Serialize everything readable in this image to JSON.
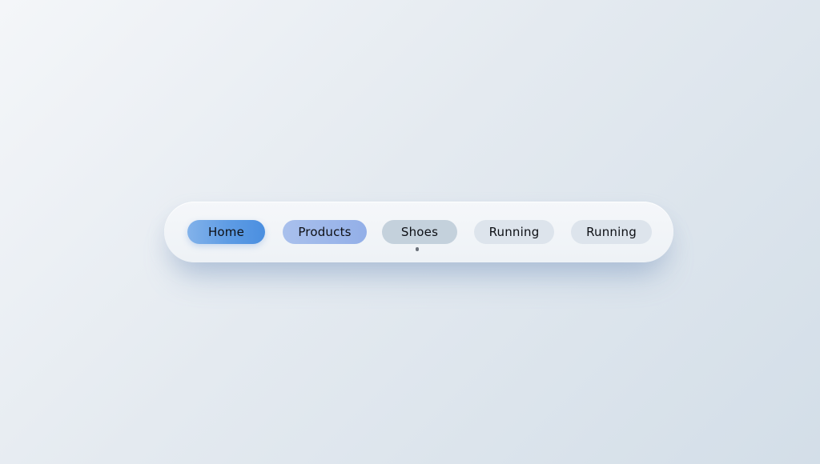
{
  "breadcrumb": {
    "items": [
      {
        "label": "Home",
        "state": "current",
        "color": "#5d9be4"
      },
      {
        "label": "Products",
        "state": "visited",
        "color": "#93afe8"
      },
      {
        "label": "Shoes",
        "state": "hovered",
        "color": "#c4d1dc"
      },
      {
        "label": "Running",
        "state": "default",
        "color": "#dde4ec"
      },
      {
        "label": "Running",
        "state": "default",
        "color": "#dde4ec"
      }
    ]
  },
  "colors": {
    "accent": "#5d9be4",
    "text": "#0d0f14",
    "background": "#e4eaf0"
  },
  "cursor": {
    "icon": "pointer-dot-icon"
  }
}
